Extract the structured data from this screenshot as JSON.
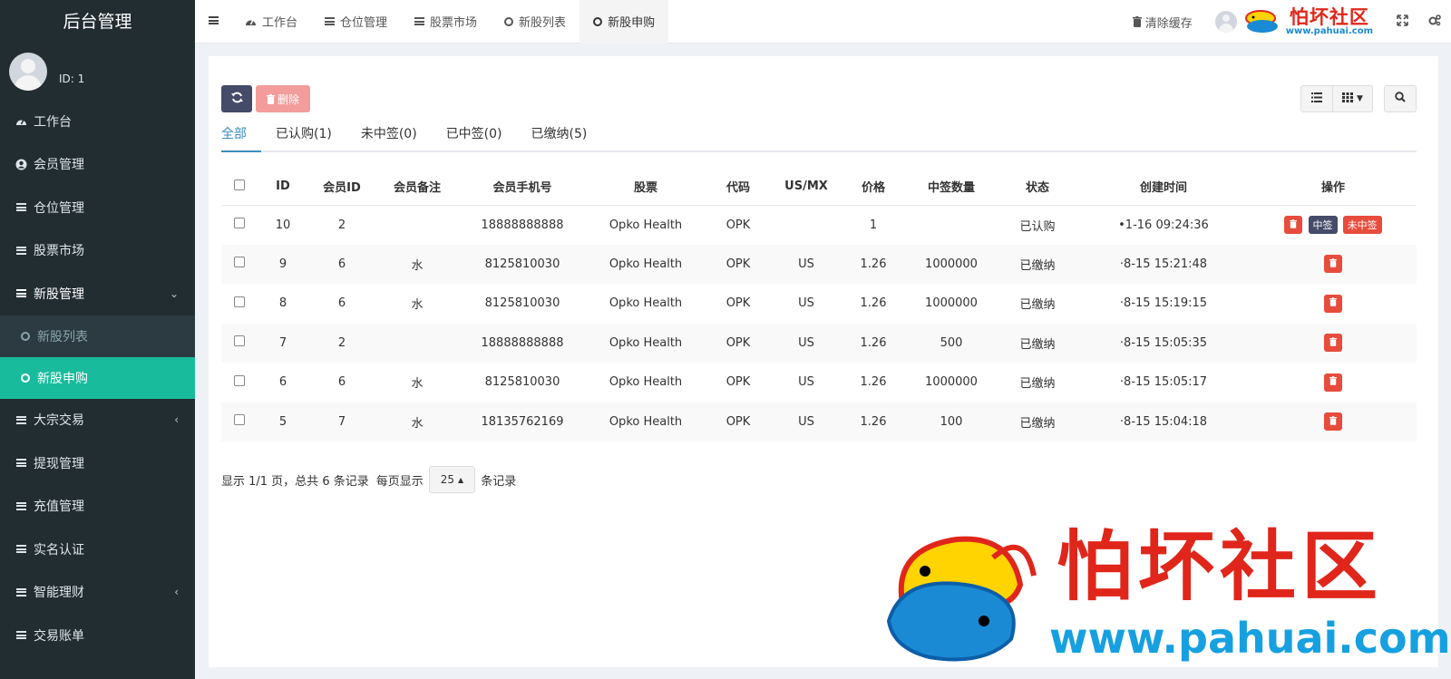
{
  "sidebar": {
    "brand": "后台管理",
    "user_id": "ID: 1",
    "items": [
      {
        "label": "工作台",
        "icon": "dashboard-icon"
      },
      {
        "label": "会员管理",
        "icon": "user-circle-icon"
      },
      {
        "label": "仓位管理",
        "icon": "menu-icon"
      },
      {
        "label": "股票市场",
        "icon": "menu-icon"
      },
      {
        "label": "新股管理",
        "icon": "menu-icon",
        "expanded": true
      },
      {
        "label": "新股列表",
        "icon": "circle-icon"
      },
      {
        "label": "新股申购",
        "icon": "circle-icon",
        "active": true
      },
      {
        "label": "大宗交易",
        "icon": "menu-icon"
      },
      {
        "label": "提现管理",
        "icon": "menu-icon"
      },
      {
        "label": "充值管理",
        "icon": "menu-icon"
      },
      {
        "label": "实名认证",
        "icon": "menu-icon"
      },
      {
        "label": "智能理财",
        "icon": "menu-icon"
      },
      {
        "label": "交易账单",
        "icon": "menu-icon"
      }
    ]
  },
  "topbar": {
    "tabs": [
      {
        "label": "工作台",
        "icon": "dashboard-icon"
      },
      {
        "label": "仓位管理",
        "icon": "menu-icon"
      },
      {
        "label": "股票市场",
        "icon": "menu-icon"
      },
      {
        "label": "新股列表",
        "icon": "circle-icon"
      },
      {
        "label": "新股申购",
        "icon": "circle-icon",
        "active": true
      }
    ],
    "clear_cache": "清除缓存",
    "logo_text": "怕坏社区",
    "logo_url": "www.pahuai.com"
  },
  "toolbar": {
    "delete_label": "删除"
  },
  "filter_tabs": [
    "全部",
    "已认购(1)",
    "未中签(0)",
    "已中签(0)",
    "已缴纳(5)"
  ],
  "table": {
    "columns": [
      "ID",
      "会员ID",
      "会员备注",
      "会员手机号",
      "股票",
      "代码",
      "US/MX",
      "价格",
      "中签数量",
      "状态",
      "创建时间",
      "操作"
    ],
    "rows": [
      {
        "id": "10",
        "member_id": "2",
        "note": "",
        "phone": "18888888888",
        "stock": "Opko Health",
        "code": "OPK",
        "market": "",
        "price": "1",
        "qty": "",
        "status": "已认购",
        "created": "•1-16 09:24:36",
        "actions": "full"
      },
      {
        "id": "9",
        "member_id": "6",
        "note": "水",
        "phone": "8125810030",
        "stock": "Opko Health",
        "code": "OPK",
        "market": "US",
        "price": "1.26",
        "qty": "1000000",
        "status": "已缴纳",
        "created": "·8-15 15:21:48",
        "actions": "delete"
      },
      {
        "id": "8",
        "member_id": "6",
        "note": "水",
        "phone": "8125810030",
        "stock": "Opko Health",
        "code": "OPK",
        "market": "US",
        "price": "1.26",
        "qty": "1000000",
        "status": "已缴纳",
        "created": "·8-15 15:19:15",
        "actions": "delete"
      },
      {
        "id": "7",
        "member_id": "2",
        "note": "",
        "phone": "18888888888",
        "stock": "Opko Health",
        "code": "OPK",
        "market": "US",
        "price": "1.26",
        "qty": "500",
        "status": "已缴纳",
        "created": "·8-15 15:05:35",
        "actions": "delete"
      },
      {
        "id": "6",
        "member_id": "6",
        "note": "水",
        "phone": "8125810030",
        "stock": "Opko Health",
        "code": "OPK",
        "market": "US",
        "price": "1.26",
        "qty": "1000000",
        "status": "已缴纳",
        "created": "·8-15 15:05:17",
        "actions": "delete"
      },
      {
        "id": "5",
        "member_id": "7",
        "note": "水",
        "phone": "18135762169",
        "stock": "Opko Health",
        "code": "OPK",
        "market": "US",
        "price": "1.26",
        "qty": "100",
        "status": "已缴纳",
        "created": "·8-15 15:04:18",
        "actions": "delete"
      }
    ],
    "action_labels": {
      "win": "中签",
      "lose": "未中签"
    }
  },
  "pager": {
    "summary": "显示 1/1 页，总共 6 条记录",
    "per_page_prefix": "每页显示",
    "per_page_value": "25",
    "per_page_suffix": "条记录"
  },
  "watermark": {
    "text": "怕坏社区",
    "url": "www.pahuai.com"
  },
  "colors": {
    "sidebar_bg": "#222d32",
    "active_green": "#18bc9c",
    "navy_button": "#444c69",
    "danger": "#e74c3c",
    "link_blue": "#3c8dbc"
  }
}
